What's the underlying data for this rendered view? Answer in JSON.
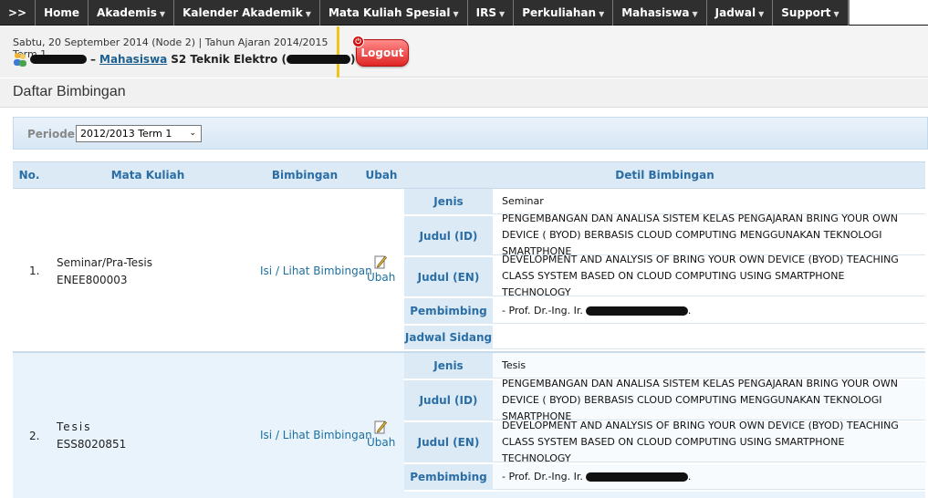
{
  "nav": {
    "toggle": ">>",
    "items": [
      {
        "label": "Home",
        "dropdown": false
      },
      {
        "label": "Akademis",
        "dropdown": true
      },
      {
        "label": "Kalender Akademik",
        "dropdown": true
      },
      {
        "label": "Mata Kuliah Spesial",
        "dropdown": true
      },
      {
        "label": "IRS",
        "dropdown": true
      },
      {
        "label": "Perkuliahan",
        "dropdown": true
      },
      {
        "label": "Mahasiswa",
        "dropdown": true
      },
      {
        "label": "Jadwal",
        "dropdown": true
      },
      {
        "label": "Support",
        "dropdown": true
      }
    ]
  },
  "header": {
    "date_line": "Sabtu, 20 September 2014 (Node 2) | Tahun Ajaran 2014/2015 Term 1",
    "separator": "–",
    "role": "Mahasiswa",
    "program": "S2 Teknik Elektro (",
    "program_close": ")",
    "logout_label": "Logout"
  },
  "page": {
    "title": "Daftar Bimbingan"
  },
  "filter": {
    "label": "Periode",
    "selected": "2012/2013 Term 1"
  },
  "table": {
    "headers": {
      "no": "No.",
      "matkul": "Mata Kuliah",
      "bimbingan": "Bimbingan",
      "ubah": "Ubah",
      "detil": "Detil Bimbingan"
    },
    "rows": [
      {
        "no": "1.",
        "mk_name": "Seminar/Pra-Tesis",
        "mk_code": "ENEE800003",
        "bimbingan_link": "Isi / Lihat Bimbingan",
        "ubah": "Ubah",
        "details": [
          {
            "label": "Jenis",
            "value": "Seminar"
          },
          {
            "label": "Judul (ID)",
            "value": "PENGEMBANGAN DAN ANALISA SISTEM KELAS PENGAJARAN BRING YOUR OWN DEVICE ( BYOD) BERBASIS CLOUD COMPUTING MENGGUNAKAN TEKNOLOGI SMARTPHONE"
          },
          {
            "label": "Judul (EN)",
            "value": "DEVELOPMENT AND ANALYSIS OF BRING YOUR OWN DEVICE (BYOD) TEACHING CLASS SYSTEM BASED ON CLOUD COMPUTING USING SMARTPHONE TECHNOLOGY"
          },
          {
            "label": "Pembimbing",
            "value": "- Prof. Dr.-Ing. Ir."
          },
          {
            "label": "Jadwal Sidang",
            "value": ""
          }
        ]
      },
      {
        "no": "2.",
        "mk_name": "Tesis",
        "mk_code": "ESS8020851",
        "bimbingan_link": "Isi / Lihat Bimbingan",
        "ubah": "Ubah",
        "details": [
          {
            "label": "Jenis",
            "value": "Tesis"
          },
          {
            "label": "Judul (ID)",
            "value": "PENGEMBANGAN DAN ANALISA SISTEM KELAS PENGAJARAN BRING YOUR OWN DEVICE ( BYOD) BERBASIS CLOUD COMPUTING MENGGUNAKAN TEKNOLOGI SMARTPHONE"
          },
          {
            "label": "Judul (EN)",
            "value": "DEVELOPMENT AND ANALYSIS OF BRING YOUR OWN DEVICE (BYOD) TEACHING CLASS SYSTEM BASED ON CLOUD COMPUTING USING SMARTPHONE TECHNOLOGY"
          },
          {
            "label": "Pembimbing",
            "value": "- Prof. Dr.-Ing. Ir."
          }
        ]
      }
    ]
  }
}
